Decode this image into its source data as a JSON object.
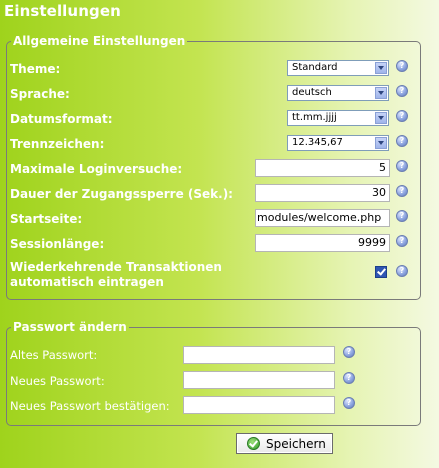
{
  "page": {
    "title": "Einstellungen"
  },
  "general": {
    "legend": "Allgemeine Einstellungen",
    "theme": {
      "label": "Theme:",
      "value": "Standard"
    },
    "language": {
      "label": "Sprache:",
      "value": "deutsch"
    },
    "date_format": {
      "label": "Datumsformat:",
      "value": "tt.mm.jjjj"
    },
    "separator": {
      "label": "Trennzeichen:",
      "value": "12.345,67"
    },
    "max_logins": {
      "label": "Maximale Loginversuche:",
      "value": "5"
    },
    "lock_duration": {
      "label": "Dauer der Zugangssperre (Sek.):",
      "value": "30"
    },
    "start_page": {
      "label": "Startseite:",
      "value": "modules/welcome.php"
    },
    "session_length": {
      "label": "Sessionlänge:",
      "value": "9999"
    },
    "recurring": {
      "label_line1": "Wiederkehrende Transaktionen",
      "label_line2": "automatisch eintragen",
      "checked": true
    }
  },
  "password": {
    "legend": "Passwort ändern",
    "old": {
      "label": "Altes Passwort:",
      "value": ""
    },
    "new": {
      "label": "Neues Passwort:",
      "value": ""
    },
    "confirm": {
      "label": "Neues Passwort bestätigen:",
      "value": ""
    }
  },
  "help_icon": {
    "name": "help-icon",
    "glyph": "?"
  },
  "save_button": {
    "label": "Speichern",
    "icon": "check-circle-icon"
  }
}
